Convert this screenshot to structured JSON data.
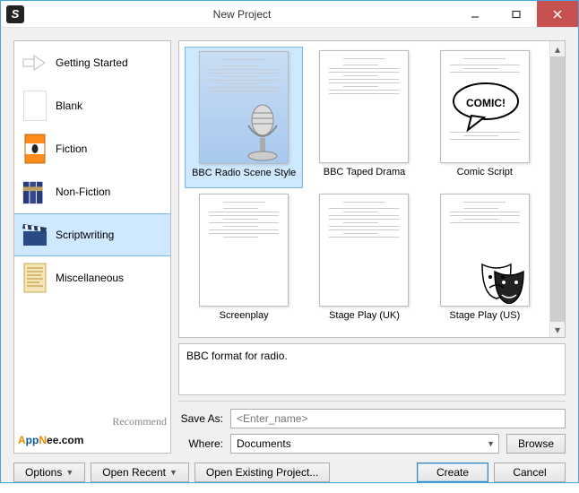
{
  "window": {
    "title": "New Project"
  },
  "sidebar": {
    "categories": [
      {
        "id": "getting-started",
        "label": "Getting Started"
      },
      {
        "id": "blank",
        "label": "Blank"
      },
      {
        "id": "fiction",
        "label": "Fiction"
      },
      {
        "id": "non-fiction",
        "label": "Non-Fiction"
      },
      {
        "id": "scriptwriting",
        "label": "Scriptwriting"
      },
      {
        "id": "miscellaneous",
        "label": "Miscellaneous"
      }
    ],
    "selected": "scriptwriting"
  },
  "templates": [
    {
      "id": "bbc-radio",
      "label": "BBC Radio Scene Style",
      "selected": true,
      "overlay": "microphone"
    },
    {
      "id": "bbc-taped",
      "label": "BBC Taped Drama"
    },
    {
      "id": "comic",
      "label": "Comic Script",
      "overlay": "comic"
    },
    {
      "id": "screenplay",
      "label": "Screenplay"
    },
    {
      "id": "stage-uk",
      "label": "Stage Play (UK)"
    },
    {
      "id": "stage-us",
      "label": "Stage Play (US)",
      "overlay": "masks"
    }
  ],
  "description": "BBC format for radio.",
  "form": {
    "save_as_label": "Save As:",
    "save_as_placeholder": "<Enter_name>",
    "where_label": "Where:",
    "where_value": "Documents",
    "browse_label": "Browse"
  },
  "buttons": {
    "options": "Options",
    "open_recent": "Open Recent",
    "open_existing": "Open Existing Project...",
    "create": "Create",
    "cancel": "Cancel"
  },
  "watermark": {
    "brand": "AppNee.com",
    "tag": "Recommend"
  },
  "overlay_text": {
    "comic": "COMIC!"
  }
}
